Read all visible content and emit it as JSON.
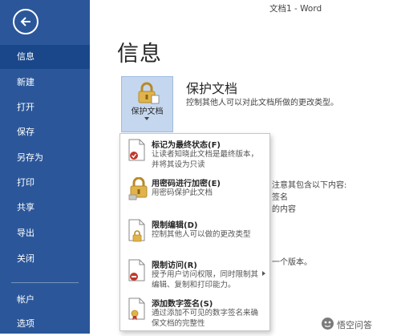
{
  "window": {
    "title": "文档1 - Word"
  },
  "nav": {
    "back_icon": "back-arrow-icon",
    "items": [
      {
        "label": "信息",
        "active": true
      },
      {
        "label": "新建"
      },
      {
        "label": "打开"
      },
      {
        "label": "保存"
      },
      {
        "label": "另存为"
      },
      {
        "label": "打印"
      },
      {
        "label": "共享"
      },
      {
        "label": "导出"
      },
      {
        "label": "关闭"
      },
      {
        "label": "帐户"
      },
      {
        "label": "选项"
      }
    ]
  },
  "main": {
    "page_title": "信息",
    "protect": {
      "button_label": "保护文档",
      "heading": "保护文档",
      "description": "控制其他人可以对此文档所做的更改类型。"
    },
    "background_text": {
      "inspect_line": "注意其包含以下内容:",
      "item1": "签名",
      "item2": "的内容",
      "versions_line": "一个版本。"
    }
  },
  "menu": {
    "items": [
      {
        "title": "标记为最终状态(F)",
        "description": "让读者知晓此文档是最终版本，并将其设为只读",
        "icon": "mark-final-document-icon"
      },
      {
        "title": "用密码进行加密(E)",
        "description": "用密码保护此文档",
        "icon": "key-lock-icon"
      },
      {
        "title": "限制编辑(D)",
        "description": "控制其他人可以做的更改类型",
        "icon": "restrict-editing-icon"
      },
      {
        "title": "限制访问(R)",
        "description": "授予用户访问权限，同时限制其编辑、复制和打印能力。",
        "icon": "restrict-access-icon",
        "has_submenu": true
      },
      {
        "title": "添加数字签名(S)",
        "description": "通过添加不可见的数字签名来确保文档的完整性",
        "icon": "digital-signature-icon"
      }
    ]
  },
  "watermark": {
    "text": "悟空问答"
  },
  "colors": {
    "nav_bg": "#2b579a",
    "nav_active": "#19478a",
    "button_bg": "#c5d7ef",
    "lock_gold": "#e0b44a"
  }
}
